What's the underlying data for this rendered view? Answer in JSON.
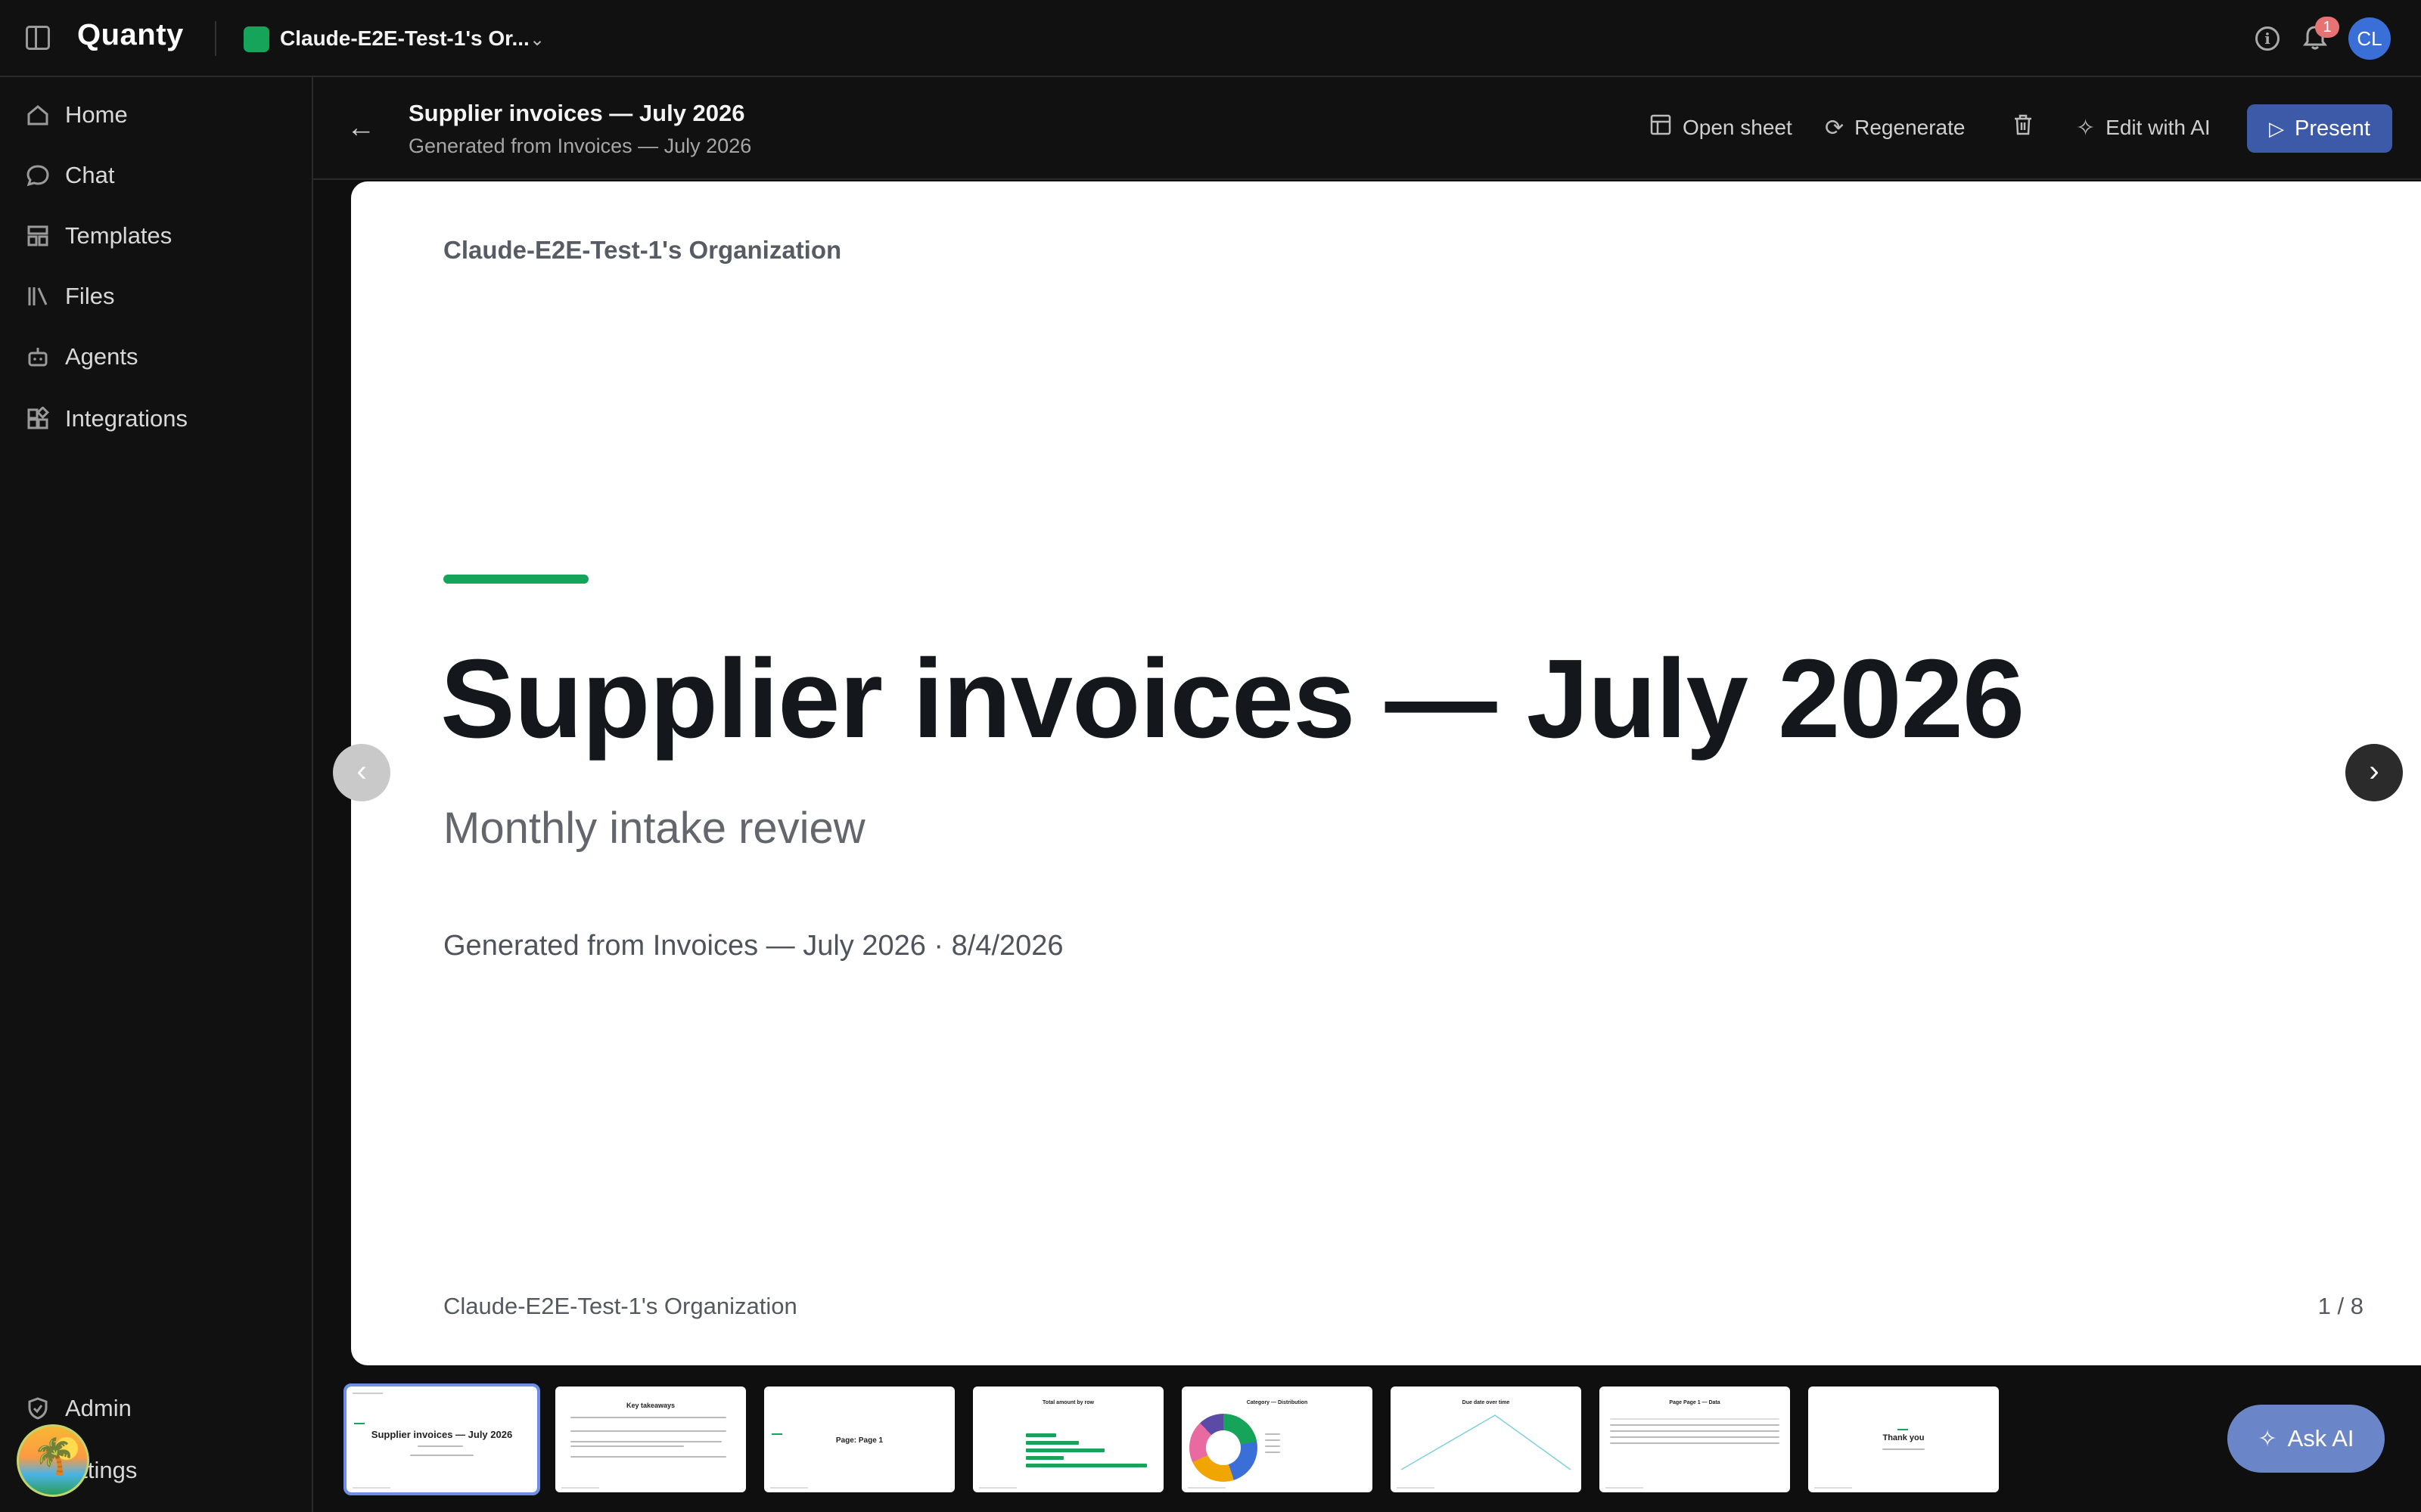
{
  "app": {
    "logo": "Quanty",
    "org_name": "Claude-E2E-Test-1's Or...",
    "notification_count": "1",
    "avatar_initials": "CL"
  },
  "sidebar": {
    "items": [
      {
        "label": "Home",
        "icon": "home-icon"
      },
      {
        "label": "Chat",
        "icon": "chat-icon"
      },
      {
        "label": "Templates",
        "icon": "templates-icon"
      },
      {
        "label": "Files",
        "icon": "files-icon"
      },
      {
        "label": "Agents",
        "icon": "agents-icon"
      },
      {
        "label": "Integrations",
        "icon": "integrations-icon"
      }
    ],
    "admin_label": "Admin",
    "settings_label": "ettings"
  },
  "header": {
    "title": "Supplier invoices — July 2026",
    "subtitle": "Generated from Invoices — July 2026",
    "open_sheet_label": "Open sheet",
    "regenerate_label": "Regenerate",
    "edit_ai_label": "Edit with AI",
    "present_label": "Present"
  },
  "slide": {
    "org_top": "Claude-E2E-Test-1's Organization",
    "title": "Supplier invoices — July 2026",
    "subtitle": "Monthly intake review",
    "meta": "Generated from Invoices — July 2026 · 8/4/2026",
    "org_bottom": "Claude-E2E-Test-1's Organization",
    "page_indicator": "1 / 8"
  },
  "thumbnails": [
    {
      "title": "Supplier invoices — July 2026",
      "active": true
    },
    {
      "title": "Key takeaways"
    },
    {
      "title": "Page: Page 1"
    },
    {
      "title": "Total amount by row"
    },
    {
      "title": "Category — Distribution"
    },
    {
      "title": "Due date over time"
    },
    {
      "title": "Page Page 1 — Data"
    },
    {
      "title": "Thank you"
    }
  ],
  "ask_ai_label": "Ask AI",
  "colors": {
    "accent_green": "#16a35a",
    "primary_blue": "#3d5aa8",
    "ask_ai_blue": "#6b86c8",
    "badge_red": "#e57373"
  }
}
